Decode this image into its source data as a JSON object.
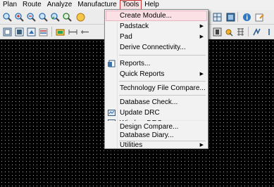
{
  "menubar": {
    "items": [
      "Plan",
      "Route",
      "Analyze",
      "Manufacture",
      "Tools",
      "Help"
    ],
    "active": "Tools"
  },
  "tools_menu": {
    "items": [
      {
        "label": "Create Module...",
        "submenu": false,
        "icon": null
      },
      {
        "label": "Padstack",
        "submenu": true,
        "icon": null
      },
      {
        "label": "Pad",
        "submenu": true,
        "icon": null
      },
      {
        "label": "Derive Connectivity...",
        "submenu": false,
        "icon": null
      },
      {
        "label": "Reports...",
        "submenu": false,
        "icon": "reports-icon"
      },
      {
        "label": "Quick Reports",
        "submenu": true,
        "icon": null
      },
      {
        "label": "Technology File Compare...",
        "submenu": false,
        "icon": null
      },
      {
        "label": "Database Check...",
        "submenu": false,
        "icon": null
      },
      {
        "label": "Update DRC",
        "submenu": false,
        "icon": "update-drc-icon"
      },
      {
        "label": "Window DRC",
        "submenu": false,
        "icon": "window-drc-icon"
      },
      {
        "label": "Design Compare...",
        "submenu": false,
        "icon": null
      },
      {
        "label": "Database Diary...",
        "submenu": false,
        "icon": null
      },
      {
        "label": "Utilities",
        "submenu": true,
        "icon": null
      }
    ],
    "highlighted": "Create Module...",
    "submenu_arrow": "▶"
  },
  "toolbar1_icons": [
    "zoom-fit-icon",
    "zoom-in-icon",
    "zoom-out-icon",
    "zoom-window-icon",
    "zoom-previous-icon",
    "zoom-world-icon",
    "redraw-icon",
    "view-3d-icon",
    "grid-icon",
    "info-icon",
    "properties-icon"
  ],
  "toolbar2_icons": [
    "rect-icon",
    "shape-icon",
    "fill-icon",
    "net-icon",
    "component-icon",
    "measure-icon",
    "dimension-icon",
    "film-icon",
    "pin-icon",
    "logic-icon",
    "route-icon"
  ],
  "colors": {
    "highlight": "#fbe1e6",
    "menubar_active_border": "#c43a3a",
    "canvas": "#000000"
  }
}
